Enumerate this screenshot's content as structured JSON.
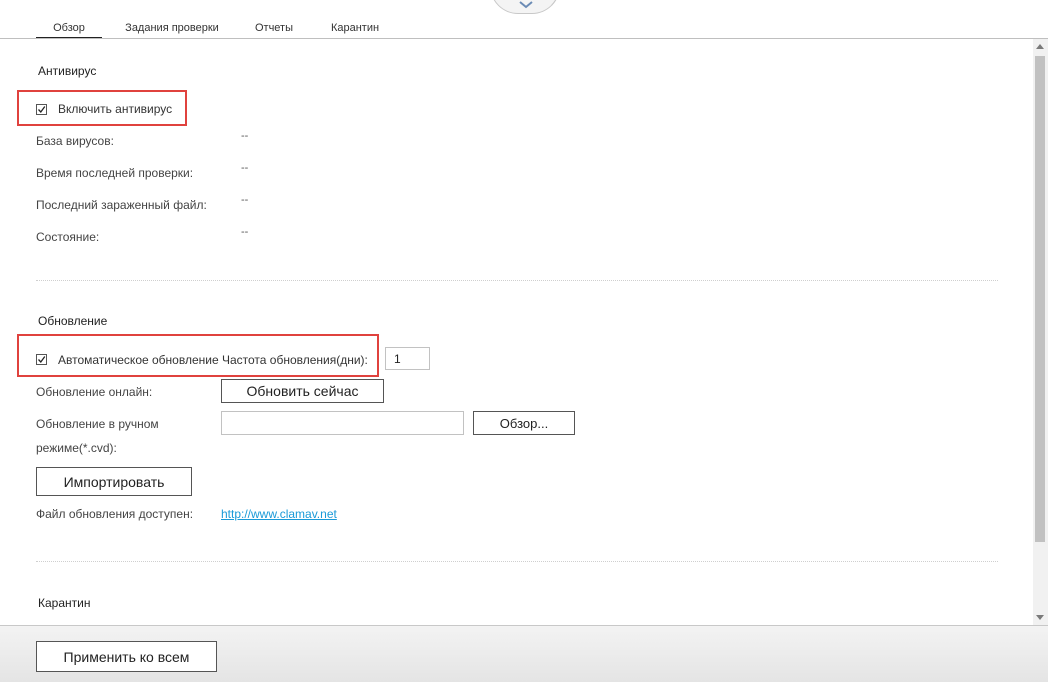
{
  "tabs": [
    {
      "label": "Обзор",
      "active": true
    },
    {
      "label": "Задания проверки",
      "active": false
    },
    {
      "label": "Отчеты",
      "active": false
    },
    {
      "label": "Карантин",
      "active": false
    }
  ],
  "antivirus": {
    "title": "Антивирус",
    "enable_label": "Включить антивирус",
    "enable_checked": true,
    "rows": [
      {
        "label": "База вирусов:",
        "value": "--"
      },
      {
        "label": "Время последней проверки:",
        "value": "--"
      },
      {
        "label": "Последний зараженный файл:",
        "value": "--"
      },
      {
        "label": "Состояние:",
        "value": "--"
      }
    ]
  },
  "update": {
    "title": "Обновление",
    "auto_label": "Автоматическое обновление Частота обновления(дни):",
    "auto_checked": true,
    "frequency_value": "1",
    "online_label": "Обновление онлайн:",
    "update_now_button": "Обновить сейчас",
    "manual_label_line1": "Обновление в ручном",
    "manual_label_line2": "режиме(*.cvd):",
    "manual_file_value": "",
    "browse_button": "Обзор...",
    "import_button": "Импортировать",
    "file_available_label": "Файл обновления доступен:",
    "file_available_link": "http://www.clamav.net"
  },
  "quarantine": {
    "title": "Карантин"
  },
  "footer": {
    "apply_all_button": "Применить ко всем"
  },
  "colors": {
    "highlight": "#e0423e",
    "link": "#1a9ad8"
  }
}
